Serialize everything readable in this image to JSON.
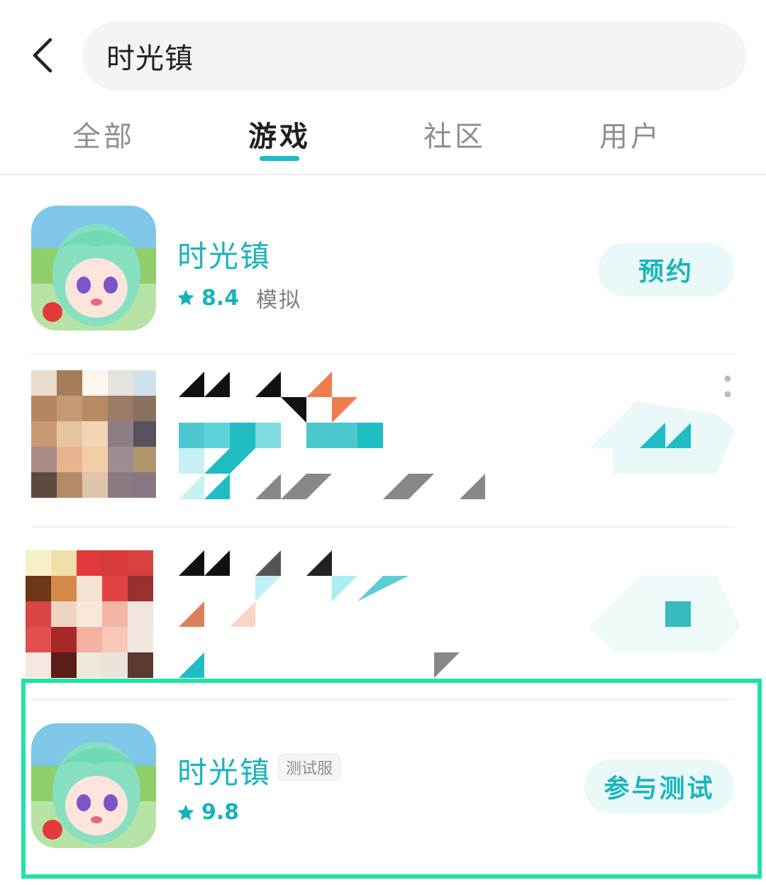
{
  "search": {
    "query": "时光镇"
  },
  "tabs": [
    {
      "label": "全部",
      "active": false
    },
    {
      "label": "游戏",
      "active": true
    },
    {
      "label": "社区",
      "active": false
    },
    {
      "label": "用户",
      "active": false
    }
  ],
  "results": [
    {
      "title": "时光镇",
      "rating": "8.4",
      "category": "模拟",
      "button": "预约"
    },
    {
      "title": "时光镇",
      "badge": "测试服",
      "rating": "9.8",
      "button": "参与测试"
    }
  ],
  "colors": {
    "accent": "#17b3bc",
    "button_bg": "#e9f8f8",
    "highlight": "#1fe3a6"
  },
  "icons": [
    "back-arrow-icon",
    "star-icon",
    "more-vertical-icon"
  ]
}
